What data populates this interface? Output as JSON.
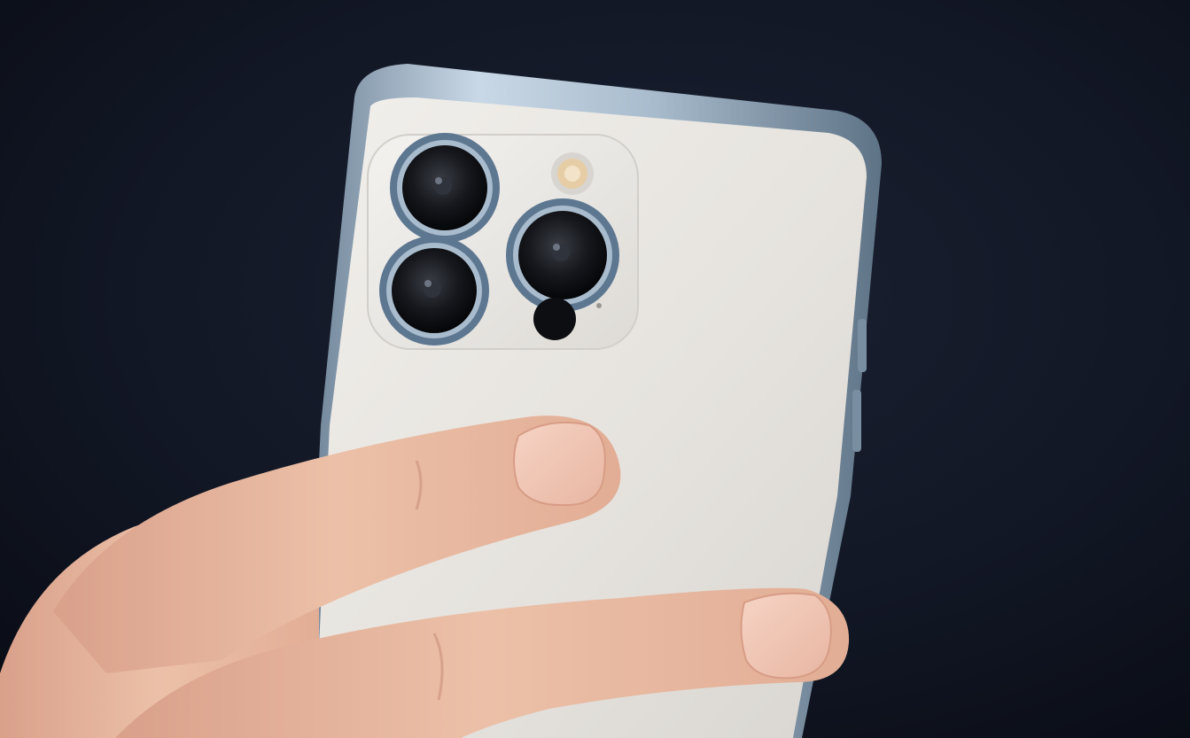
{
  "scene": {
    "subject": "smartphone-back-held-in-hand",
    "phone_color": "#e9e7e3",
    "frame_color": "#9fb3c6",
    "background_color": "#10141f",
    "skin_color": "#e7b49a",
    "lens_ring_color": "#7d98b3",
    "lens_count": 3
  }
}
